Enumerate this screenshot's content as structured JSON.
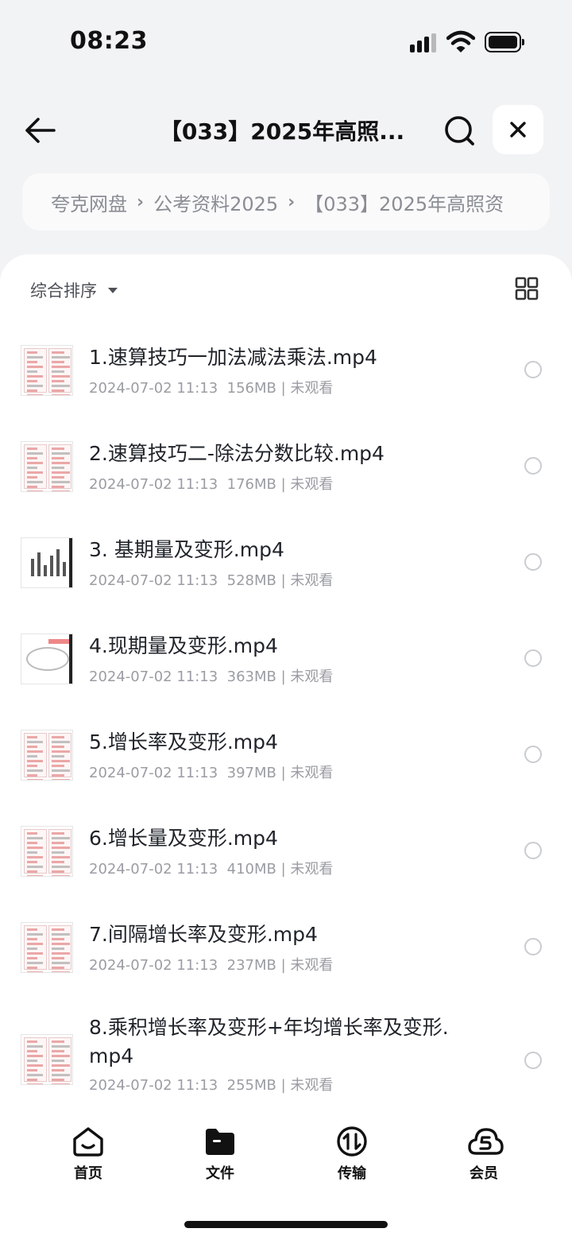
{
  "status": {
    "time": "08:23"
  },
  "header": {
    "title": "【033】2025年高照..."
  },
  "breadcrumb": [
    {
      "label": "夸克网盘"
    },
    {
      "label": "公考资料2025"
    },
    {
      "label": "【033】2025年高照资"
    }
  ],
  "toolbar": {
    "sort_label": "综合排序"
  },
  "files": [
    {
      "name": "1.速算技巧一加法减法乘法.mp4",
      "date": "2024-07-02 11:13",
      "size": "156MB",
      "status": "未观看",
      "thumb": "doc"
    },
    {
      "name": "2.速算技巧二-除法分数比较.mp4",
      "date": "2024-07-02 11:13",
      "size": "176MB",
      "status": "未观看",
      "thumb": "doc"
    },
    {
      "name": "3. 基期量及变形.mp4",
      "date": "2024-07-02 11:13",
      "size": "528MB",
      "status": "未观看",
      "thumb": "chart"
    },
    {
      "name": "4.现期量及变形.mp4",
      "date": "2024-07-02 11:13",
      "size": "363MB",
      "status": "未观看",
      "thumb": "arc"
    },
    {
      "name": "5.增长率及变形.mp4",
      "date": "2024-07-02 11:13",
      "size": "397MB",
      "status": "未观看",
      "thumb": "doc"
    },
    {
      "name": "6.增长量及变形.mp4",
      "date": "2024-07-02 11:13",
      "size": "410MB",
      "status": "未观看",
      "thumb": "doc"
    },
    {
      "name": "7.间隔增长率及变形.mp4",
      "date": "2024-07-02 11:13",
      "size": "237MB",
      "status": "未观看",
      "thumb": "doc"
    },
    {
      "name": "8.乘积增长率及变形+年均增长率及变形.mp4",
      "date": "2024-07-02 11:13",
      "size": "255MB",
      "status": "未观看",
      "thumb": "doc"
    }
  ],
  "tabs": [
    {
      "label": "首页",
      "icon": "home-icon"
    },
    {
      "label": "文件",
      "icon": "folder-icon"
    },
    {
      "label": "传输",
      "icon": "transfer-icon"
    },
    {
      "label": "会员",
      "icon": "vip-cloud-icon"
    }
  ]
}
